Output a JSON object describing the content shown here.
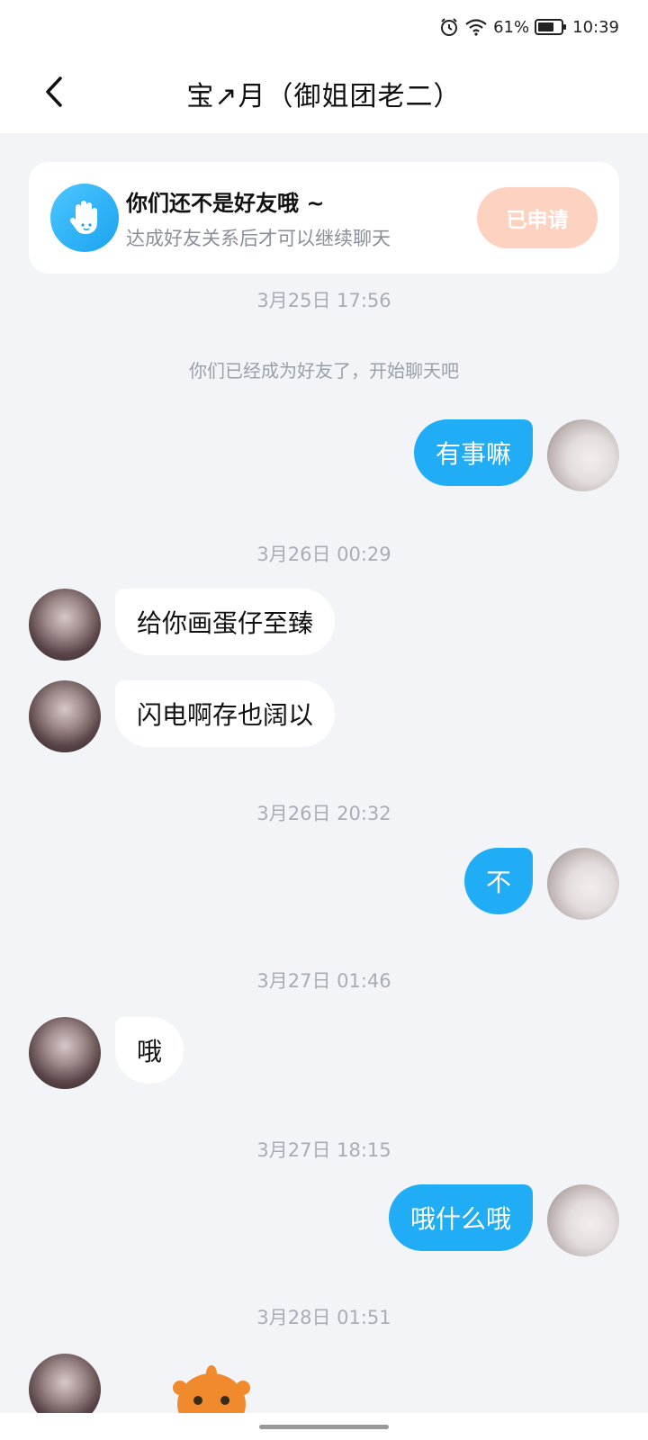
{
  "status_bar": {
    "battery_percent": "61%",
    "time": "10:39",
    "icons": [
      "alarm-icon",
      "wifi-icon",
      "battery-icon"
    ]
  },
  "header": {
    "title": "宝↗月（御姐团老二）",
    "back_icon": "chevron-left-icon"
  },
  "friend_card": {
    "title": "你们还不是好友哦 ~",
    "subtitle": "达成好友关系后才可以继续聊天",
    "button_label": "已申请",
    "icon": "hand-icon"
  },
  "chat": {
    "partial_timestamp": "3月25日 17:56",
    "system_message": "你们已经成为好友了，开始聊天吧",
    "messages": [
      {
        "side": "out",
        "text": "有事嘛"
      },
      {
        "timestamp": "3月26日 00:29"
      },
      {
        "side": "in",
        "text": "给你画蛋仔至臻"
      },
      {
        "side": "in",
        "text": "闪电啊存也阔以"
      },
      {
        "timestamp": "3月26日 20:32"
      },
      {
        "side": "out",
        "text": "不"
      },
      {
        "timestamp": "3月27日 01:46"
      },
      {
        "side": "in",
        "text": "哦"
      },
      {
        "timestamp": "3月27日 18:15"
      },
      {
        "side": "out",
        "text": "哦什么哦"
      },
      {
        "timestamp": "3月28日 01:51"
      }
    ]
  },
  "colors": {
    "accent_blue": "#21adf5",
    "applied_button": "#fdd2c0",
    "background": "#f2f4f7"
  }
}
